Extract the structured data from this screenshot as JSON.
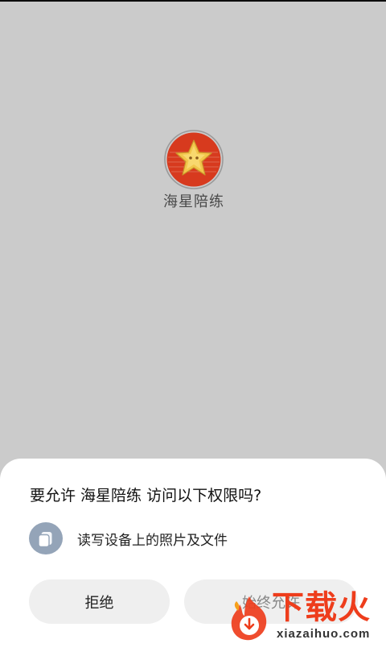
{
  "app": {
    "name": "海星陪练"
  },
  "dialog": {
    "title": "要允许 海星陪练 访问以下权限吗?",
    "permission": {
      "icon": "document-copy-icon",
      "label": "读写设备上的照片及文件"
    },
    "deny_label": "拒绝",
    "allow_label": "始终允许"
  },
  "watermark": {
    "title": "下载火",
    "url": "xiazaihuo.com"
  },
  "colors": {
    "background_dim": "#cbcbcb",
    "icon_red": "#d73a1e",
    "star_gold": "#f2c64b",
    "permission_icon_bg": "#94a4b8",
    "button_bg": "#efefef",
    "watermark_red": "#ee3d1c"
  }
}
